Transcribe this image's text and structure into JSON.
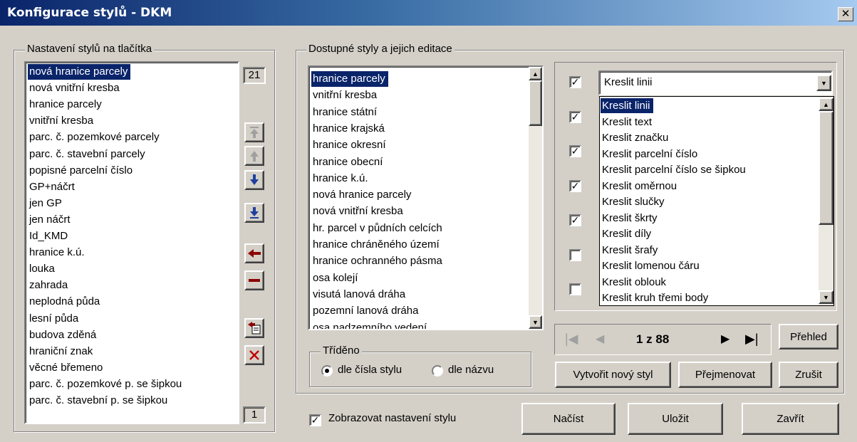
{
  "window": {
    "title": "Konfigurace stylů - DKM",
    "close_symbol": "✕"
  },
  "left_group": {
    "label": "Nastavení stylů na tlačítka",
    "top_count": "21",
    "bottom_count": "1",
    "items": [
      "nová hranice parcely",
      "nová vnitřní kresba",
      "hranice parcely",
      "vnitřní kresba",
      "parc. č. pozemkové parcely",
      "parc. č. stavební parcely",
      "popisné parcelní číslo",
      "GP+náčrt",
      "jen GP",
      "jen náčrt",
      "Id_KMD",
      "hranice k.ú.",
      "louka",
      "zahrada",
      "neplodná půda",
      "lesní půda",
      "budova zděná",
      "hraniční znak",
      "věcné břemeno",
      "parc. č. pozemkové p. se šipkou",
      "parc. č. stavební p. se šipkou"
    ],
    "selected_index": 0,
    "icons": [
      "move-top-icon",
      "move-up-icon",
      "move-down-icon",
      "move-bottom-icon",
      "add-arrow-icon",
      "remove-minus-icon",
      "insert-icon",
      "delete-x-icon"
    ]
  },
  "middle_group": {
    "label": "Dostupné styly a jejich editace",
    "items": [
      "hranice parcely",
      "vnitřní kresba",
      "hranice státní",
      "hranice krajská",
      "hranice okresní",
      "hranice obecní",
      "hranice k.ú.",
      "nová hranice parcely",
      "nová vnitřní kresba",
      "hr. parcel v půdních celcích",
      "hranice chráněného území",
      "hranice ochranného pásma",
      "osa kolejí",
      "visutá lanová dráha",
      "pozemní lanová dráha",
      "osa nadzemního vedení"
    ],
    "selected_index": 0,
    "sort": {
      "label": "Tříděno",
      "options": [
        "dle čísla stylu",
        "dle názvu"
      ],
      "selected": 0
    }
  },
  "right_panel": {
    "checkboxes": [
      true,
      true,
      true,
      true,
      true,
      false,
      false
    ],
    "combo_value": "Kreslit linii",
    "dropdown_items": [
      "Kreslit linii",
      "Kreslit text",
      "Kreslit značku",
      "Kreslit parcelní číslo",
      "Kreslit parcelní číslo se šipkou",
      "Kreslit oměrnou",
      "Kreslit slučky",
      "Kreslit škrty",
      "Kreslit díly",
      "Kreslit šrafy",
      "Kreslit lomenou čáru",
      "Kreslit oblouk",
      "Kreslit kruh třemi body"
    ],
    "dropdown_selected": 0
  },
  "navigator": {
    "position": "1 z 88",
    "overview_label": "Přehled"
  },
  "actions": {
    "create_label": "Vytvořit nový styl",
    "rename_label": "Přejmenovat",
    "cancel_label": "Zrušit"
  },
  "footer": {
    "show_settings_label": "Zobrazovat nastavení stylu",
    "show_settings_checked": true,
    "load_label": "Načíst",
    "save_label": "Uložit",
    "close_label": "Zavřít"
  },
  "colors": {
    "selection": "#0a246a",
    "face": "#d4d0c8",
    "arrow_blue": "#1f3f9f",
    "arrow_red": "#8b0000"
  }
}
